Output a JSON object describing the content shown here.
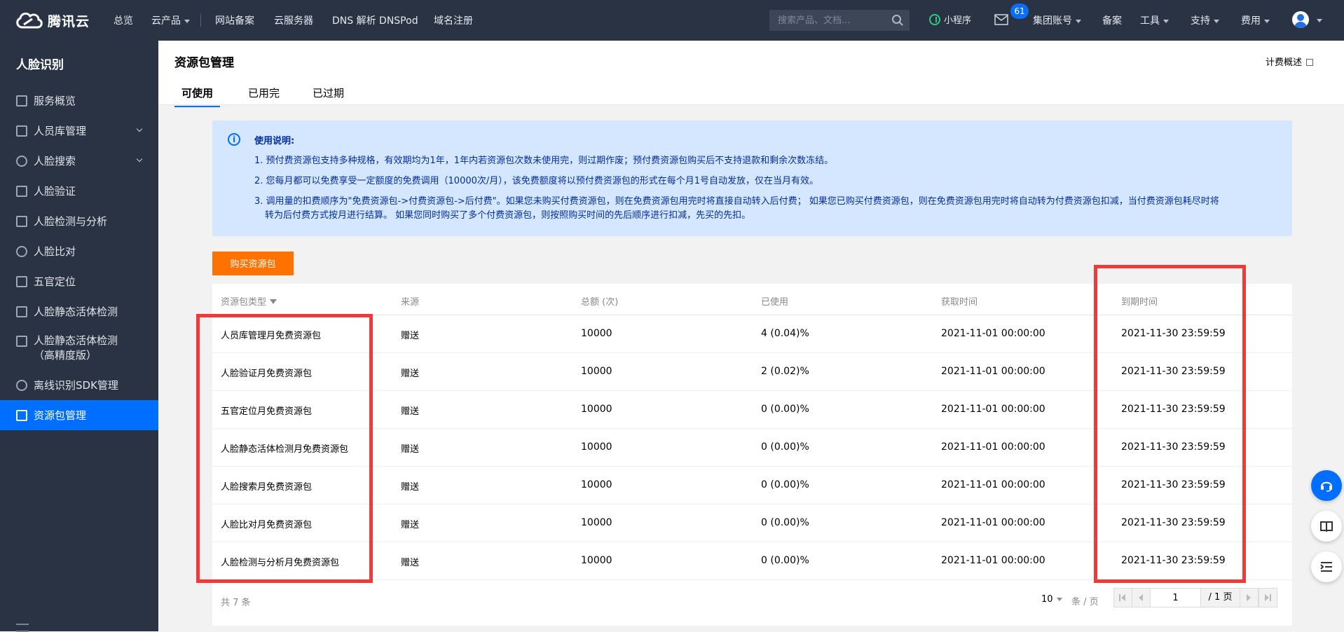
{
  "topbar": {
    "brand": "腾讯云",
    "nav": [
      "总览",
      "云产品",
      "网站备案",
      "云服务器",
      "DNS 解析 DNSPod",
      "域名注册"
    ],
    "search_placeholder": "搜索产品、文档...",
    "mini_program": "小程序",
    "mail_badge": "61",
    "right_nav": [
      "集团账号",
      "备案",
      "工具",
      "支持",
      "费用"
    ]
  },
  "sidebar": {
    "title": "人脸识别",
    "items": [
      {
        "label": "服务概览"
      },
      {
        "label": "人员库管理"
      },
      {
        "label": "人脸搜索"
      },
      {
        "label": "人脸验证"
      },
      {
        "label": "人脸检测与分析"
      },
      {
        "label": "人脸比对"
      },
      {
        "label": "五官定位"
      },
      {
        "label": "人脸静态活体检测"
      },
      {
        "label": "人脸静态活体检测",
        "sub": "（高精度版）"
      },
      {
        "label": "离线识别SDK管理"
      },
      {
        "label": "资源包管理"
      }
    ]
  },
  "header": {
    "title": "资源包管理",
    "billing_link": "计费概述",
    "tabs": [
      "可使用",
      "已用完",
      "已过期"
    ]
  },
  "notice": {
    "title": "使用说明:",
    "lines": [
      "1. 预付费资源包支持多种规格，有效期均为1年，1年内若资源包次数未使用完，则过期作废；预付费资源包购买后不支持退款和剩余次数冻结。",
      "2. 您每月都可以免费享受一定额度的免费调用（10000次/月），该免费额度将以预付费资源包的形式在每个月1号自动发放，仅在当月有效。",
      "3. 调用量的扣费顺序为\"免费资源包->付费资源包->后付费\"。如果您未购买付费资源包，则在免费资源包用完时将直接自动转入后付费； 如果您已购买付费资源包，则在免费资源包用完时将自动转为付费资源包扣减，当付费资源包耗尽时将",
      "转为后付费方式按月进行结算。 如果您同时购买了多个付费资源包，则按照购买时间的先后顺序进行扣减，先买的先扣。"
    ]
  },
  "buy_button": "购买资源包",
  "table": {
    "headers": [
      "资源包类型",
      "来源",
      "总额 (次)",
      "已使用",
      "获取时间",
      "到期时间"
    ],
    "rows": [
      [
        "人员库管理月免费资源包",
        "赠送",
        "10000",
        "4 (0.04)%",
        "2021-11-01 00:00:00",
        "2021-11-30 23:59:59"
      ],
      [
        "人脸验证月免费资源包",
        "赠送",
        "10000",
        "2 (0.02)%",
        "2021-11-01 00:00:00",
        "2021-11-30 23:59:59"
      ],
      [
        "五官定位月免费资源包",
        "赠送",
        "10000",
        "0 (0.00)%",
        "2021-11-01 00:00:00",
        "2021-11-30 23:59:59"
      ],
      [
        "人脸静态活体检测月免费资源包",
        "赠送",
        "10000",
        "0 (0.00)%",
        "2021-11-01 00:00:00",
        "2021-11-30 23:59:59"
      ],
      [
        "人脸搜索月免费资源包",
        "赠送",
        "10000",
        "0 (0.00)%",
        "2021-11-01 00:00:00",
        "2021-11-30 23:59:59"
      ],
      [
        "人脸比对月免费资源包",
        "赠送",
        "10000",
        "0 (0.00)%",
        "2021-11-01 00:00:00",
        "2021-11-30 23:59:59"
      ],
      [
        "人脸检测与分析月免费资源包",
        "赠送",
        "10000",
        "0 (0.00)%",
        "2021-11-01 00:00:00",
        "2021-11-30 23:59:59"
      ]
    ]
  },
  "pagination": {
    "total": "共 7 条",
    "page_size": "10",
    "per_page": "条 / 页",
    "current_page": "1",
    "total_pages": "/ 1 页"
  },
  "colors": {
    "topbar": "#2a3343",
    "sidebar": "#293343",
    "accent": "#006eff",
    "buy_button": "#ff7200",
    "highlight": "#f03a3a"
  }
}
